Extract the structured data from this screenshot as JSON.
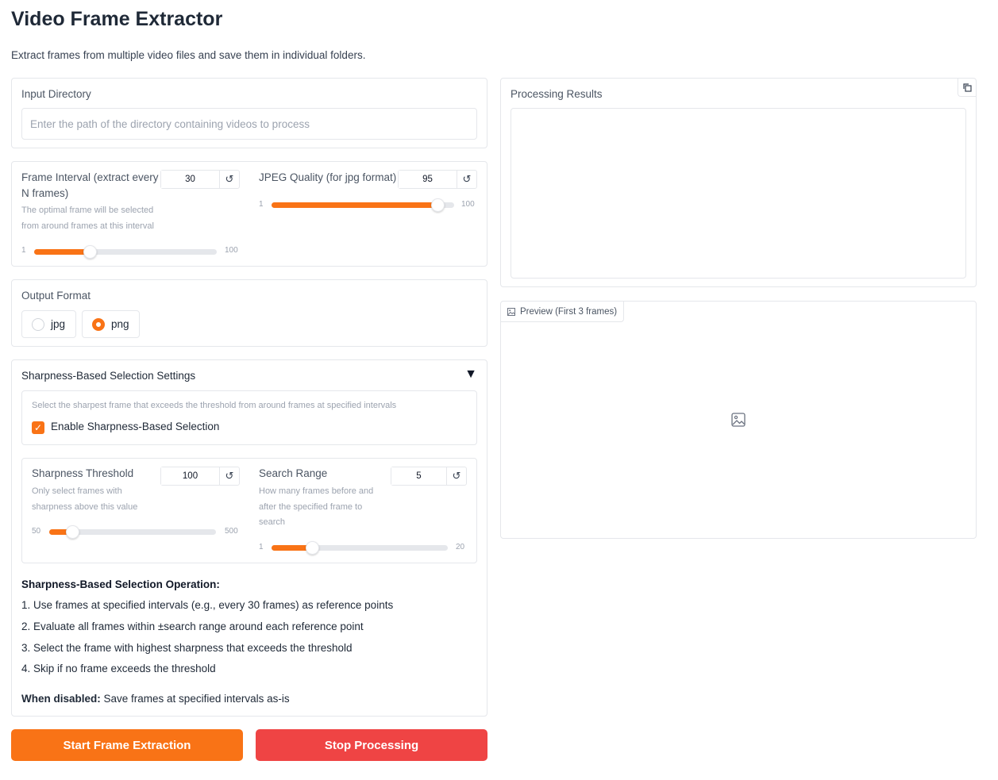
{
  "app": {
    "title": "Video Frame Extractor",
    "description": "Extract frames from multiple video files and save them in individual folders."
  },
  "input_directory": {
    "label": "Input Directory",
    "placeholder": "Enter the path of the directory containing videos to process",
    "value": ""
  },
  "frame_interval": {
    "label_line1": "Frame Interval (extract every",
    "label_line2": "N frames)",
    "info_line1": "The optimal frame will be selected",
    "info_line2": "from around frames at this interval",
    "value": "30",
    "min": "1",
    "max": "100",
    "reset_icon": "↺"
  },
  "jpeg_quality": {
    "label": "JPEG Quality (for jpg format)",
    "value": "95",
    "min": "1",
    "max": "100",
    "reset_icon": "↺"
  },
  "output_format": {
    "label": "Output Format",
    "options": [
      {
        "label": "jpg",
        "selected": false
      },
      {
        "label": "png",
        "selected": true
      }
    ]
  },
  "sharpness": {
    "title": "Sharpness-Based Selection Settings",
    "toggle_icon": "▼",
    "description": "Select the sharpest frame that exceeds the threshold from around frames at specified intervals",
    "enable_label": "Enable Sharpness-Based Selection",
    "enabled": true,
    "threshold": {
      "label": "Sharpness Threshold",
      "info_line1": "Only select frames with",
      "info_line2": "sharpness above this value",
      "value": "100",
      "min": "50",
      "max": "500",
      "reset_icon": "↺"
    },
    "search_range": {
      "label": "Search Range",
      "info_line1": "How many frames before and",
      "info_line2": "after the specified frame to",
      "info_line3": "search",
      "value": "5",
      "min": "1",
      "max": "20",
      "reset_icon": "↺"
    },
    "operation": {
      "heading": "Sharpness-Based Selection Operation:",
      "steps": [
        "1. Use frames at specified intervals (e.g., every 30 frames) as reference points",
        "2. Evaluate all frames within ±search range around each reference point",
        "3. Select the frame with highest sharpness that exceeds the threshold",
        "4. Skip if no frame exceeds the threshold"
      ],
      "disabled_label": "When disabled:",
      "disabled_text": " Save frames at specified intervals as-is"
    }
  },
  "results": {
    "label": "Processing Results",
    "value": "",
    "copy_icon": "copy-icon"
  },
  "preview": {
    "label": "Preview (First 3 frames)",
    "label_icon": "image-icon",
    "empty_icon": "image-icon"
  },
  "buttons": {
    "start": "Start Frame Extraction",
    "stop": "Stop Processing"
  },
  "colors": {
    "accent": "#f97316",
    "stop": "#ef4444",
    "border": "#e5e7eb"
  }
}
